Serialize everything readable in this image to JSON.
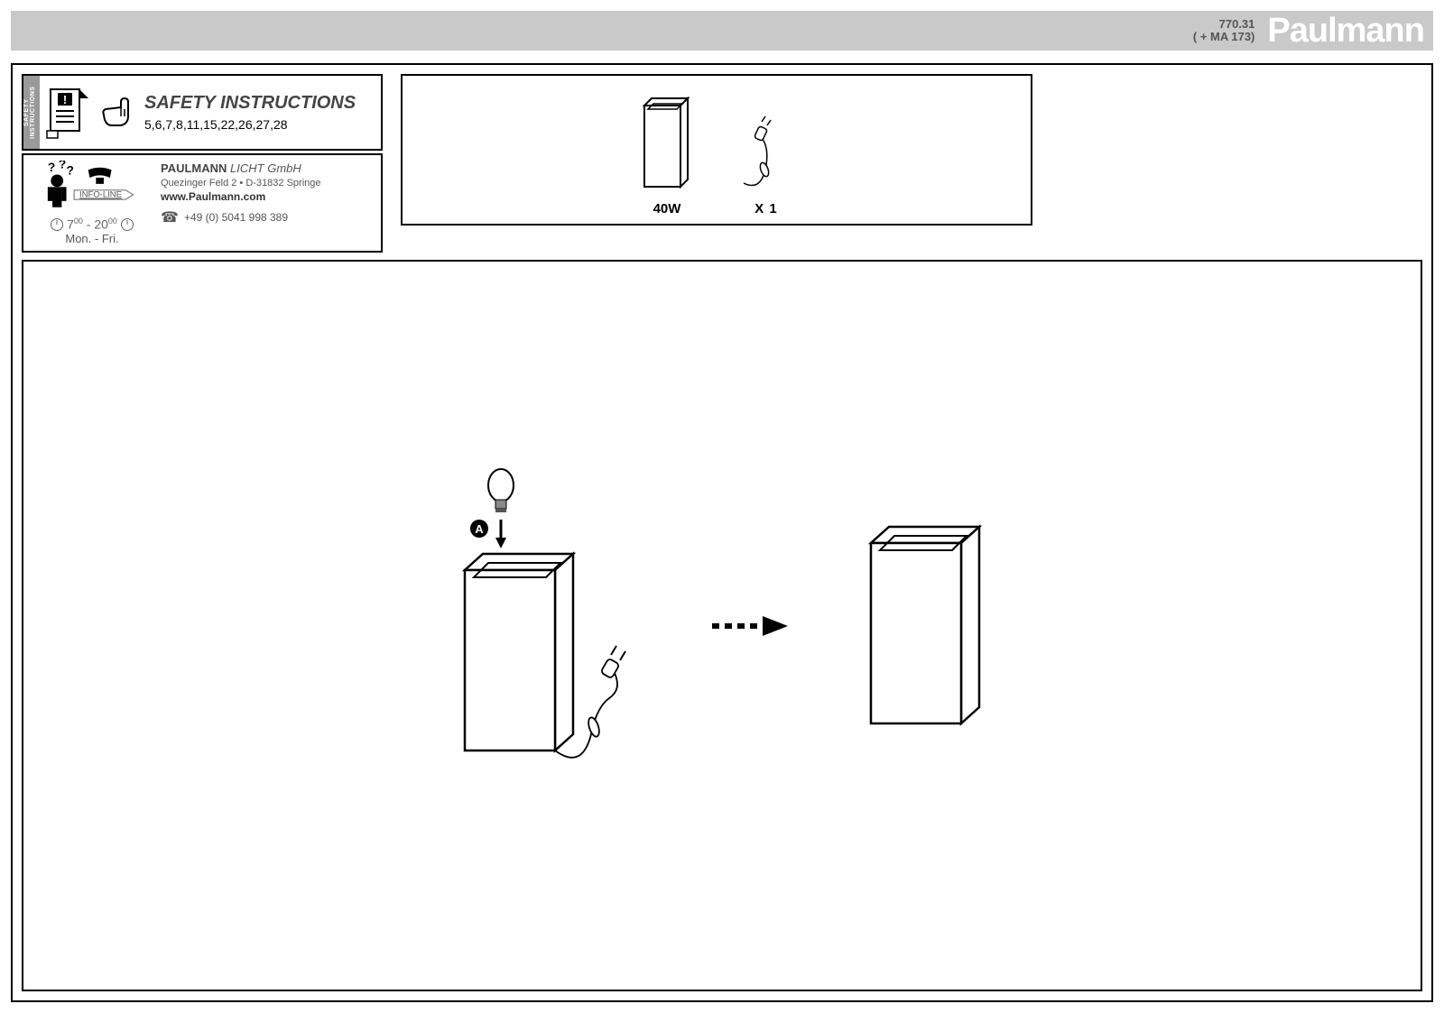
{
  "header": {
    "product_code": "770.31",
    "ma_code": "( + MA 173)",
    "brand": "Paulmann"
  },
  "safety": {
    "tab": "SAFETY INSTRUCTIONS",
    "title": "SAFETY INSTRUCTIONS",
    "numbers": "5,6,7,8,11,15,22,26,27,28"
  },
  "contact": {
    "company_bold": "PAULMANN",
    "company_light": " LICHT GmbH",
    "address": "Quezinger Feld 2 • D-31832 Springe",
    "website": "www.Paulmann.com",
    "phone": "+49 (0) 5041 998 389",
    "hours": "7⁰⁰ - 20⁰⁰",
    "days": "Mon. - Fri.",
    "infoline": "INFO-LINE"
  },
  "overview": {
    "wattage": "40W",
    "quantity": "X 1"
  },
  "assembly": {
    "step_label": "A"
  }
}
